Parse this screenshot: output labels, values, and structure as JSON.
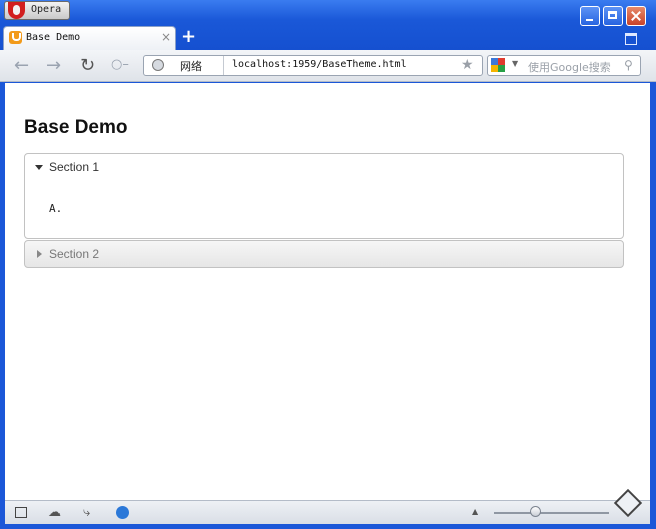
{
  "browser": {
    "menu_label": "Opera",
    "tab_title": "Base Demo",
    "tab_close": "×",
    "new_tab": "+",
    "address_network": "网络",
    "url": "localhost:1959/BaseTheme.html",
    "search_placeholder": "使用Google搜索"
  },
  "page": {
    "title": "Base Demo",
    "sections": [
      {
        "label": "Section 1",
        "expanded": true,
        "content": "A."
      },
      {
        "label": "Section 2",
        "expanded": false
      }
    ]
  },
  "colors": {
    "window_chrome": "#1b57d8",
    "section_border": "#c2c2c2"
  },
  "icons": [
    "back-icon",
    "forward-icon",
    "reload-icon",
    "key-icon",
    "globe-icon",
    "star-icon",
    "google-icon",
    "magnifier-icon",
    "panel-icon",
    "cloud-icon",
    "unite-icon",
    "speed-icon",
    "zoom-fit-icon",
    "trash-icon"
  ]
}
